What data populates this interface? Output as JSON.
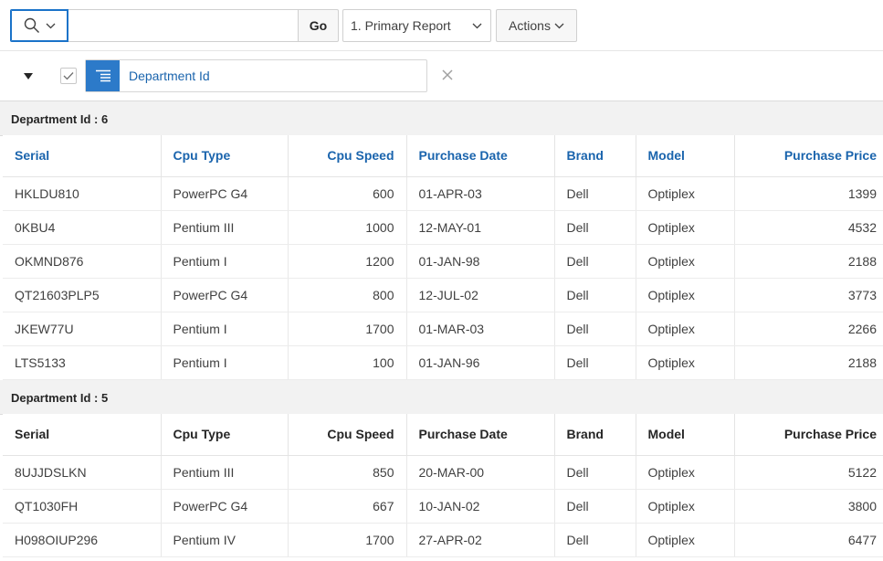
{
  "toolbar": {
    "search_placeholder": "",
    "go_label": "Go",
    "report_selected": "1. Primary Report",
    "actions_label": "Actions"
  },
  "filter": {
    "break_label": "Department Id"
  },
  "columns": [
    "Serial",
    "Cpu Type",
    "Cpu Speed",
    "Purchase Date",
    "Brand",
    "Model",
    "Purchase Price"
  ],
  "groups": [
    {
      "header": "Department Id : 6",
      "rows": [
        [
          "HKLDU810",
          "PowerPC G4",
          "600",
          "01-APR-03",
          "Dell",
          "Optiplex",
          "1399"
        ],
        [
          "0KBU4",
          "Pentium III",
          "1000",
          "12-MAY-01",
          "Dell",
          "Optiplex",
          "4532"
        ],
        [
          "OKMND876",
          "Pentium I",
          "1200",
          "01-JAN-98",
          "Dell",
          "Optiplex",
          "2188"
        ],
        [
          "QT21603PLP5",
          "PowerPC G4",
          "800",
          "12-JUL-02",
          "Dell",
          "Optiplex",
          "3773"
        ],
        [
          "JKEW77U",
          "Pentium I",
          "1700",
          "01-MAR-03",
          "Dell",
          "Optiplex",
          "2266"
        ],
        [
          "LTS5133",
          "Pentium I",
          "100",
          "01-JAN-96",
          "Dell",
          "Optiplex",
          "2188"
        ]
      ]
    },
    {
      "header": "Department Id : 5",
      "rows": [
        [
          "8UJJDSLKN",
          "Pentium III",
          "850",
          "20-MAR-00",
          "Dell",
          "Optiplex",
          "5122"
        ],
        [
          "QT1030FH",
          "PowerPC G4",
          "667",
          "10-JAN-02",
          "Dell",
          "Optiplex",
          "3800"
        ],
        [
          "H098OIUP296",
          "Pentium IV",
          "1700",
          "27-APR-02",
          "Dell",
          "Optiplex",
          "6477"
        ]
      ]
    }
  ],
  "colors": {
    "accent": "#2c7ac9",
    "link": "#1a64ad",
    "group_bg": "#f2f2f2"
  }
}
